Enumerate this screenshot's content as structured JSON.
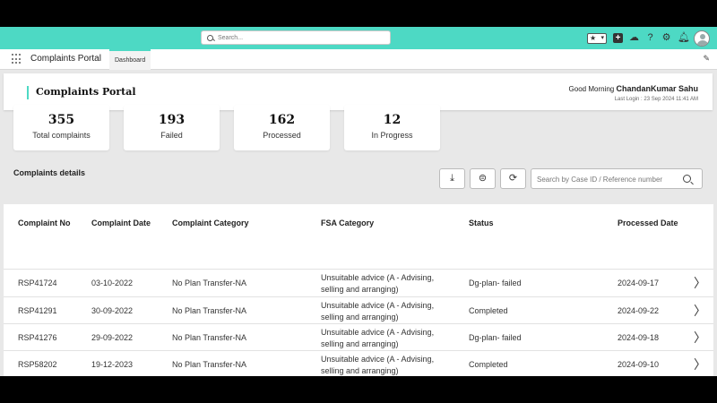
{
  "topbar": {
    "search_placeholder": "Search...",
    "favorites_icon": "star-icon",
    "icons": [
      "plus-icon",
      "cloud-icon",
      "help-icon",
      "gear-icon",
      "bell-icon",
      "avatar-icon"
    ]
  },
  "nav": {
    "app_name": "Complaints Portal",
    "tab": "Dashboard"
  },
  "header": {
    "title": "Complaints Portal",
    "greeting": "Good Morning",
    "user": "ChandanKumar Sahu",
    "last_login": "Last Login : 23 Sep 2024 11:41 AM"
  },
  "stats": [
    {
      "value": "355",
      "label": "Total complaints"
    },
    {
      "value": "193",
      "label": "Failed"
    },
    {
      "value": "162",
      "label": "Processed"
    },
    {
      "value": "12",
      "label": "In Progress"
    }
  ],
  "details": {
    "title": "Complaints details",
    "search_placeholder": "Search by Case ID / Reference number"
  },
  "table": {
    "headers": [
      "Complaint No",
      "Complaint Date",
      "Complaint Category",
      "FSA Category",
      "Status",
      "Processed Date"
    ],
    "rows": [
      {
        "no": "RSP41724",
        "date": "03-10-2022",
        "category": "No Plan Transfer-NA",
        "fsa1": "Unsuitable advice (A - Advising,",
        "fsa2": "selling and arranging)",
        "status": "Dg-plan- failed",
        "processed": "2024-09-17"
      },
      {
        "no": "RSP41291",
        "date": "30-09-2022",
        "category": "No Plan Transfer-NA",
        "fsa1": "Unsuitable advice (A - Advising,",
        "fsa2": "selling and arranging)",
        "status": "Completed",
        "processed": "2024-09-22"
      },
      {
        "no": "RSP41276",
        "date": "29-09-2022",
        "category": "No Plan Transfer-NA",
        "fsa1": "Unsuitable advice (A - Advising,",
        "fsa2": "selling and arranging)",
        "status": "Dg-plan- failed",
        "processed": "2024-09-18"
      },
      {
        "no": "RSP58202",
        "date": "19-12-2023",
        "category": "No Plan Transfer-NA",
        "fsa1": "Unsuitable advice (A - Advising,",
        "fsa2": "selling and arranging)",
        "status": "Completed",
        "processed": "2024-09-10"
      }
    ]
  },
  "colors": {
    "accent": "#4dd9c4"
  }
}
